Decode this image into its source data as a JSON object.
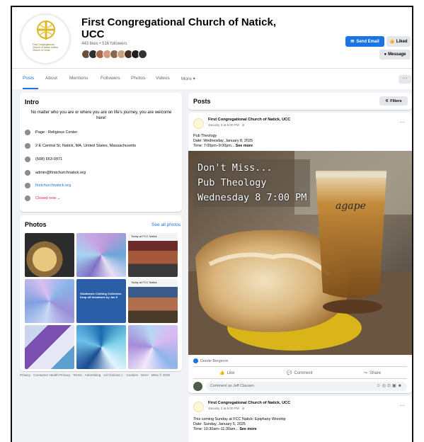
{
  "page": {
    "name": "First Congregational Church of Natick, UCC",
    "stats": "443 likes • 516 followers",
    "logo_text": "First Congregational Church of Natick United Church of Christ"
  },
  "header_buttons": {
    "send_email": "Send Email",
    "liked": "Liked",
    "message": "Message"
  },
  "tabs": [
    "Posts",
    "About",
    "Mentions",
    "Followers",
    "Photos",
    "Videos",
    "More ▾"
  ],
  "more_label": "···",
  "intro": {
    "title": "Intro",
    "bio": "No matter who you are or where you are on life's journey, you are welcome here!",
    "rows": [
      {
        "icon": "info-icon",
        "text": "Page · Religious Center"
      },
      {
        "icon": "location-icon",
        "text": "2 E Central St, Natick, MA, United States, Massachusetts"
      },
      {
        "icon": "phone-icon",
        "text": "(508) 653-0971"
      },
      {
        "icon": "email-icon",
        "text": "admin@firstchurchnatick.org"
      },
      {
        "icon": "globe-icon",
        "text": "firstchurchnatick.org"
      },
      {
        "icon": "clock-icon",
        "text": "Closed now ⌄"
      }
    ]
  },
  "photos": {
    "title": "Photos",
    "see_all": "See all photos",
    "tile_texts": {
      "pub": "Today at FCC Natick",
      "pub2": "Today at FCC Natick",
      "collection": "Gladhands Clothing Collection Drop off donations by Jan 5"
    }
  },
  "footer": "Privacy · Consumer Health Privacy · Terms · Advertising · Ad Choices ▷ · Cookies · More · Meta © 2025",
  "posts": {
    "title": "Posts",
    "filters": "Filters",
    "items": [
      {
        "author": "First Congregational Church of Natick, UCC",
        "date": "January 3 at 6:00 PM · ⊘",
        "lines": [
          "Pub Theology",
          "Date: Wednesday, January 8, 2025",
          "Time: 7:00pm–9:00pm..."
        ],
        "see_more": "See more",
        "image_overlay": [
          "Don't Miss...",
          "Pub Theology",
          "Wednesday 8 7:00 PM"
        ],
        "glass_text": "agape",
        "reactor": "Deede Bergeron",
        "actions": [
          "Like",
          "Comment",
          "Share"
        ],
        "comment_placeholder": "Comment as Jeff Clausen"
      },
      {
        "author": "First Congregational Church of Natick, UCC",
        "date": "January 2 at 6:00 PM · ⊘",
        "lines": [
          "This coming Sunday at FCC Natick: Epiphany Worship",
          "Date: Sunday, January 5, 2025",
          "Time: 10:30am–11:30am..."
        ],
        "see_more": "See more"
      }
    ]
  },
  "colors": {
    "accent": "#1b74e4",
    "page_bg": "#f0f2f5",
    "closed": "#e41e3f"
  }
}
